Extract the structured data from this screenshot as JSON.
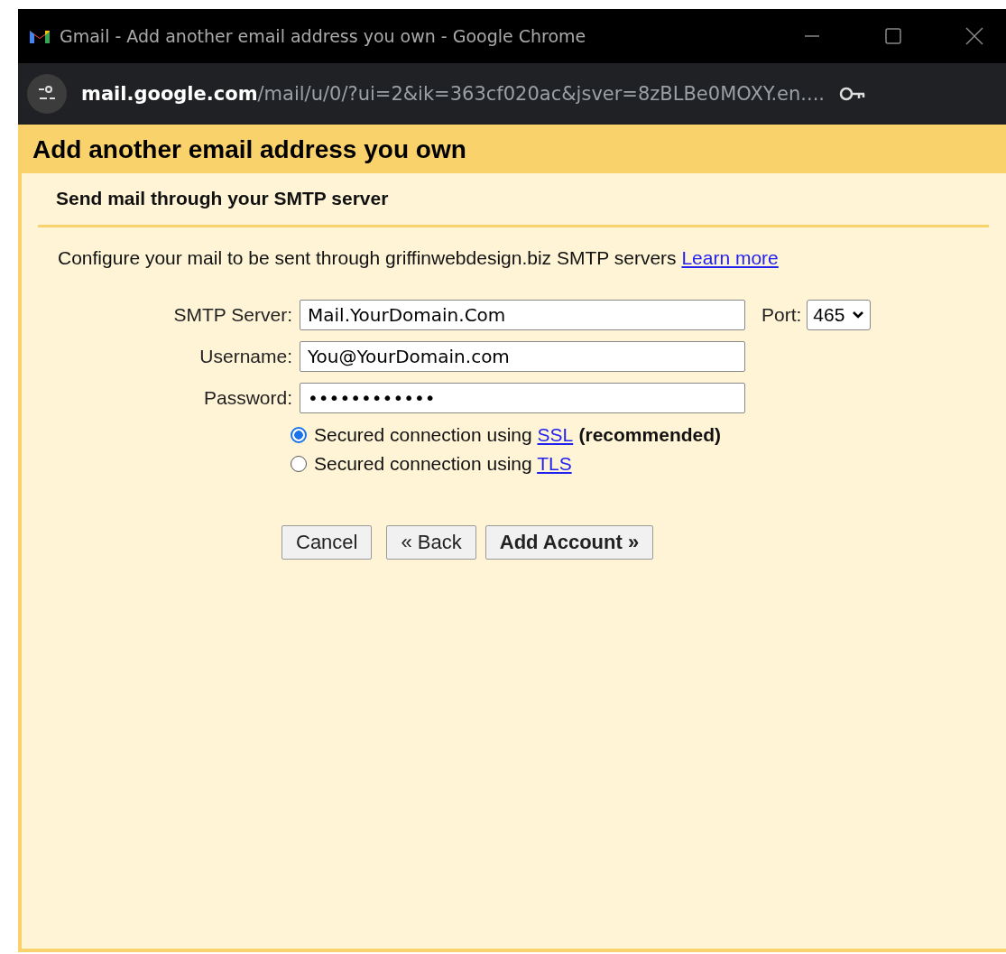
{
  "window": {
    "title": "Gmail - Add another email address you own - Google Chrome"
  },
  "address_bar": {
    "host": "mail.google.com",
    "path": "/mail/u/0/?ui=2&ik=363cf020ac&jsver=8zBLBe0MOXY.en...."
  },
  "dialog": {
    "title": "Add another email address you own",
    "section": "Send mail through your SMTP server",
    "intro": "Configure your mail to be sent through griffinwebdesign.biz SMTP servers",
    "intro_link": "Learn more",
    "fields": [
      {
        "label": "SMTP Server:",
        "value": "Mail.YourDomain.Com"
      },
      {
        "label": "Username:",
        "value": "You@YourDomain.com"
      },
      {
        "label": "Password:",
        "value": "••••••••••••"
      }
    ],
    "port": {
      "label": "Port:",
      "value": "465"
    },
    "security": [
      {
        "text": "Secured connection using",
        "link": "SSL",
        "note": "(recommended)",
        "selected": true
      },
      {
        "text": "Secured connection using",
        "link": "TLS",
        "selected": false
      }
    ],
    "buttons": [
      {
        "label": "Cancel",
        "primary": false
      },
      {
        "label": "« Back",
        "primary": false
      },
      {
        "label": "Add Account »",
        "primary": true
      }
    ]
  }
}
